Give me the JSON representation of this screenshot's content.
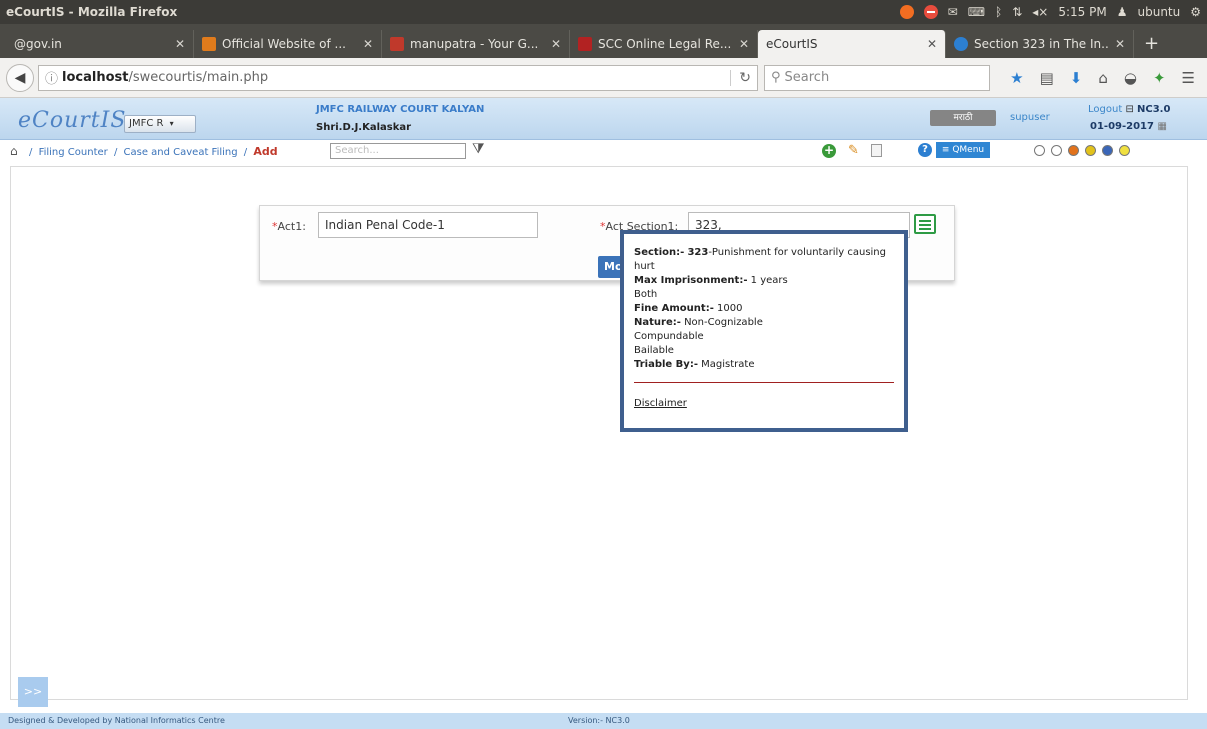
{
  "os": {
    "window_title": "eCourtIS - Mozilla Firefox",
    "time": "5:15 PM",
    "user": "ubuntu"
  },
  "tabs": [
    {
      "label": "@gov.in",
      "active": false,
      "favicon_color": "#4b4a45"
    },
    {
      "label": "Official Website of ...",
      "active": false,
      "favicon_color": "#e07b1c"
    },
    {
      "label": "manupatra - Your G...",
      "active": false,
      "favicon_color": "#c0392b"
    },
    {
      "label": "SCC Online Legal Re...",
      "active": false,
      "favicon_color": "#b22222"
    },
    {
      "label": "eCourtIS",
      "active": true,
      "favicon_color": "#f2f1ef"
    },
    {
      "label": "Section 323 in The In...",
      "active": false,
      "favicon_color": "#2c7fd1"
    }
  ],
  "navbar": {
    "url_host": "localhost",
    "url_path": "/swecourtis/main.php",
    "search_placeholder": "Search"
  },
  "header": {
    "logo": "eCourtIS",
    "court_select": "JMFC R",
    "court_name": "JMFC RAILWAY COURT KALYAN",
    "judge": "Shri.D.J.Kalaskar",
    "marathi": "मराठी",
    "user": "supuser",
    "logout": "Logout",
    "version_badge": "NC3.0",
    "date": "01-09-2017"
  },
  "breadcrumb": {
    "items": [
      "Filing Counter",
      "Case and Caveat Filing"
    ],
    "current": "Add",
    "search_placeholder": "Search...",
    "qmenu": "QMenu"
  },
  "form": {
    "act_label": "Act1:",
    "act_value": "Indian Penal Code-1",
    "section_label": "Act Section1:",
    "section_value": "323,",
    "button_label": "Mo"
  },
  "popup": {
    "section_key": "Section:-",
    "section_num": "323",
    "section_desc": "-Punishment for voluntarily causing hurt",
    "max_imp_key": "Max Imprisonment:-",
    "max_imp_val": "1 years",
    "both": "Both",
    "fine_key": "Fine Amount:-",
    "fine_val": "1000",
    "nature_key": "Nature:-",
    "nature_val": "Non-Cognizable",
    "compoundable": "Compundable",
    "bailable": "Bailable",
    "triable_key": "Triable By:-",
    "triable_val": "Magistrate",
    "disclaimer": "Disclaimer"
  },
  "expander": ">>",
  "footer": {
    "credit": "Designed & Developed by National Informatics Centre",
    "version": "Version:- NC3.0"
  },
  "colors": {
    "circle_colors": [
      "#ffffff",
      "#ffffff",
      "#e2721b",
      "#e2c21b",
      "#3a66b8",
      "#f0e040"
    ]
  }
}
